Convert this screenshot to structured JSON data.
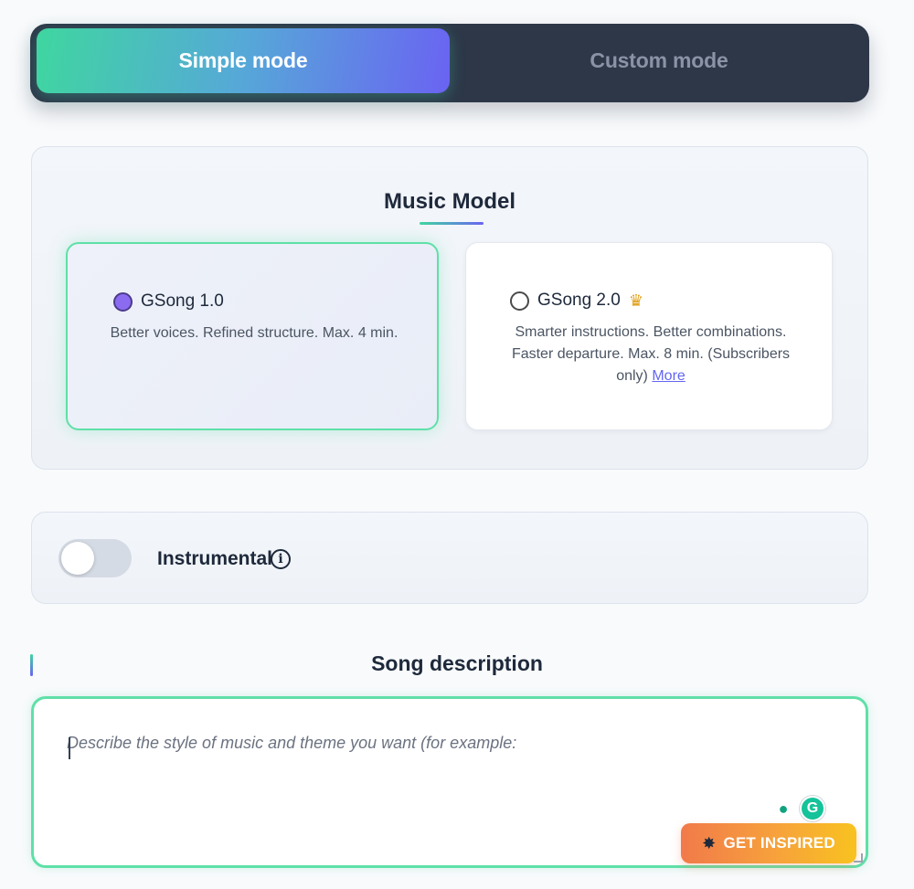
{
  "mode_switch": {
    "simple_label": "Simple mode",
    "custom_label": "Custom mode",
    "active": "Simple mode"
  },
  "music_model": {
    "title": "Music Model",
    "options": [
      {
        "name": "GSong 1.0",
        "description": "Better voices. Refined structure. Max. 4 min.",
        "selected": true
      },
      {
        "name": "GSong 2.0",
        "badge_icon": "crown-icon",
        "description": "Smarter instructions. Better combinations. Faster departure. Max. 8 min. (Subscribers only)",
        "link_label": "More",
        "selected": false
      }
    ]
  },
  "instrumental": {
    "label": "Instrumental",
    "enabled": false,
    "info_icon": "info-icon"
  },
  "song_description": {
    "title": "Song description",
    "placeholder": "Describe the style of music and theme you want (for example:",
    "value": ""
  },
  "inspire_button": {
    "label": "GET INSPIRED",
    "icon": "sparkle-icon"
  },
  "colors": {
    "accent_green": "#3fd6a0",
    "accent_purple": "#6a63f2",
    "dark_panel": "#2d3748",
    "inspire_orange": "#f17a4a",
    "inspire_yellow": "#f8c21f"
  }
}
